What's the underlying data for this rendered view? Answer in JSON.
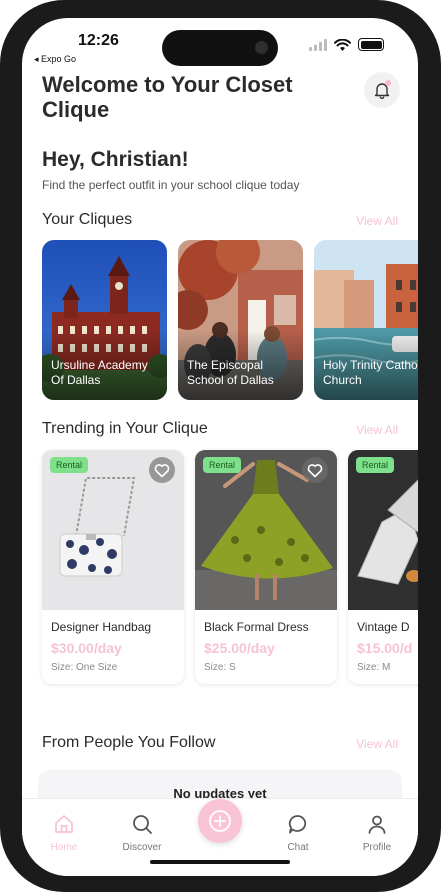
{
  "status_bar": {
    "time": "12:26",
    "back_label": "◂ Expo Go"
  },
  "header": {
    "title": "Welcome to Your Closet Clique"
  },
  "greeting": {
    "title": "Hey, Christian!",
    "subtitle": "Find the perfect outfit in your school clique today"
  },
  "sections": {
    "cliques_title": "Your Cliques",
    "trending_title": "Trending in Your Clique",
    "follow_title": "From People You Follow",
    "view_all": "View All"
  },
  "cliques": [
    {
      "name": "Ursuline Academy Of Dallas"
    },
    {
      "name": "The Episcopal School of Dallas"
    },
    {
      "name": "Holy Trinity Catholic Church"
    }
  ],
  "trending": [
    {
      "badge": "Rental",
      "name": "Designer Handbag",
      "price": "$30.00/day",
      "size": "Size: One Size"
    },
    {
      "badge": "Rental",
      "name": "Black Formal Dress",
      "price": "$25.00/day",
      "size": "Size: S"
    },
    {
      "badge": "Rental",
      "name": "Vintage D",
      "price": "$15.00/d",
      "size": "Size: M"
    }
  ],
  "follow": {
    "empty_text": "No updates yet"
  },
  "tabs": [
    {
      "label": "Home",
      "icon": "home-icon",
      "active": true
    },
    {
      "label": "Discover",
      "icon": "search-icon"
    },
    {
      "label": "",
      "icon": "plus-icon"
    },
    {
      "label": "Chat",
      "icon": "chat-icon"
    },
    {
      "label": "Profile",
      "icon": "profile-icon"
    }
  ],
  "colors": {
    "accent": "#f6c3d4",
    "badge": "#7ee08a",
    "text": "#2b2b2b"
  }
}
